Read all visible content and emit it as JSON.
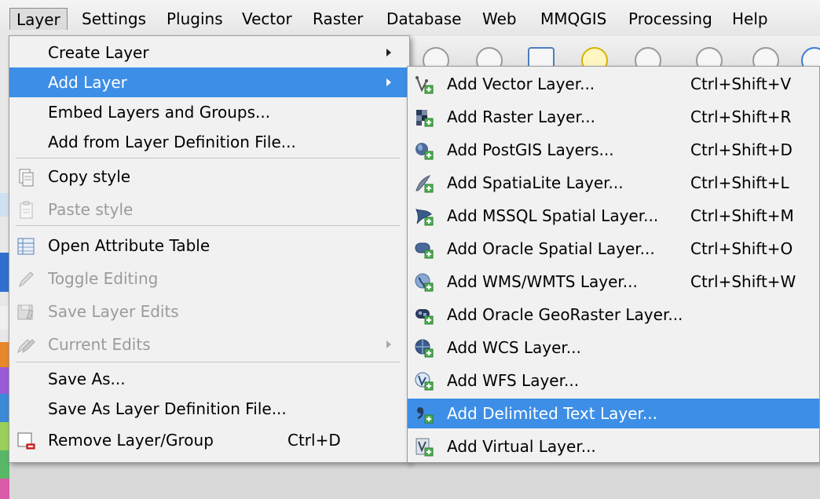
{
  "menubar": {
    "items": [
      {
        "label": "Layer"
      },
      {
        "label": "Settings"
      },
      {
        "label": "Plugins"
      },
      {
        "label": "Vector"
      },
      {
        "label": "Raster"
      },
      {
        "label": "Database"
      },
      {
        "label": "Web"
      },
      {
        "label": "MMQGIS"
      },
      {
        "label": "Processing"
      },
      {
        "label": "Help"
      }
    ]
  },
  "layer_menu": {
    "items": [
      {
        "label": "Create Layer",
        "submenu": true
      },
      {
        "label": "Add Layer",
        "submenu": true,
        "highlighted": true
      },
      {
        "label": "Embed Layers and Groups..."
      },
      {
        "label": "Add from Layer Definition File..."
      },
      {
        "label": "Copy style",
        "icon": "copy-style-icon"
      },
      {
        "label": "Paste style",
        "icon": "paste-style-icon",
        "disabled": true
      },
      {
        "label": "Open Attribute Table",
        "icon": "attribute-table-icon"
      },
      {
        "label": "Toggle Editing",
        "icon": "pencil-icon",
        "disabled": true
      },
      {
        "label": "Save Layer Edits",
        "icon": "save-edits-icon",
        "disabled": true
      },
      {
        "label": "Current Edits",
        "icon": "current-edits-icon",
        "disabled": true,
        "submenu": true
      },
      {
        "label": "Save As..."
      },
      {
        "label": "Save As Layer Definition File..."
      },
      {
        "label": "Remove Layer/Group",
        "icon": "remove-layer-icon",
        "shortcut": "Ctrl+D"
      }
    ]
  },
  "add_layer_menu": {
    "items": [
      {
        "label": "Add Vector Layer...",
        "shortcut": "Ctrl+Shift+V",
        "icon": "vector-layer-icon"
      },
      {
        "label": "Add Raster Layer...",
        "shortcut": "Ctrl+Shift+R",
        "icon": "raster-layer-icon"
      },
      {
        "label": "Add PostGIS Layers...",
        "shortcut": "Ctrl+Shift+D",
        "icon": "postgis-icon"
      },
      {
        "label": "Add SpatiaLite Layer...",
        "shortcut": "Ctrl+Shift+L",
        "icon": "spatialite-icon"
      },
      {
        "label": "Add MSSQL Spatial Layer...",
        "shortcut": "Ctrl+Shift+M",
        "icon": "mssql-icon"
      },
      {
        "label": "Add Oracle Spatial Layer...",
        "shortcut": "Ctrl+Shift+O",
        "icon": "oracle-icon"
      },
      {
        "label": "Add WMS/WMTS Layer...",
        "shortcut": "Ctrl+Shift+W",
        "icon": "wms-icon"
      },
      {
        "label": "Add Oracle GeoRaster Layer...",
        "shortcut": "",
        "icon": "georaster-icon"
      },
      {
        "label": "Add WCS Layer...",
        "shortcut": "",
        "icon": "wcs-icon"
      },
      {
        "label": "Add WFS Layer...",
        "shortcut": "",
        "icon": "wfs-icon"
      },
      {
        "label": "Add Delimited Text Layer...",
        "shortcut": "",
        "icon": "delimited-text-icon",
        "highlighted": true
      },
      {
        "label": "Add Virtual Layer...",
        "shortcut": "",
        "icon": "virtual-layer-icon"
      }
    ]
  },
  "colors": {
    "highlight": "#3d8ee6",
    "menu_bg": "#f1f1f1",
    "disabled_text": "#9b9b9b"
  }
}
